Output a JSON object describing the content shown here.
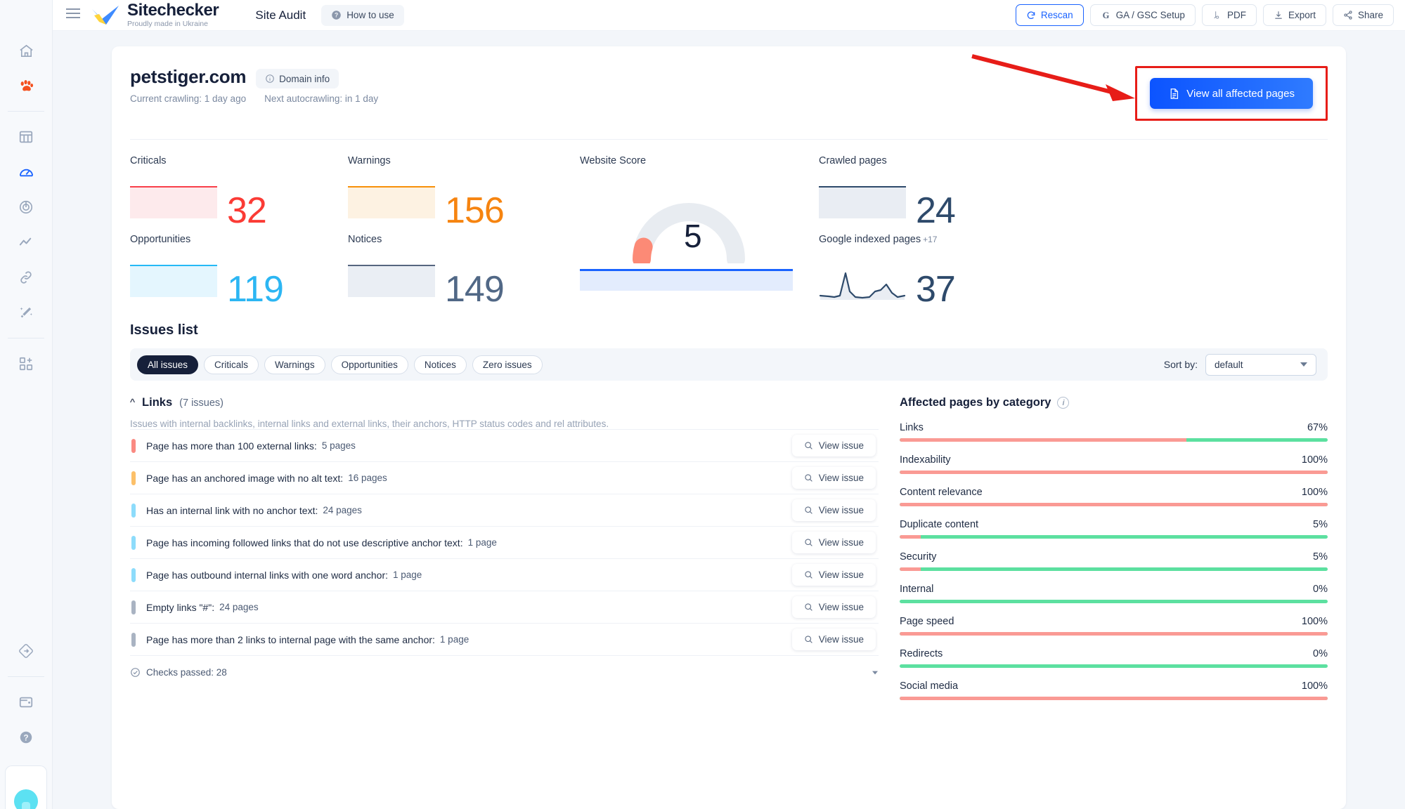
{
  "topbar": {
    "menu_icon": "hamburger-icon",
    "brand_name": "Sitechecker",
    "brand_tagline": "Proudly made in Ukraine",
    "nav_title": "Site Audit",
    "how_to_use": "How to use",
    "buttons": [
      {
        "label": "Rescan",
        "icon": "refresh-icon",
        "primary": true
      },
      {
        "label": "GA / GSC Setup",
        "icon": "google-icon",
        "primary": false
      },
      {
        "label": "PDF",
        "icon": "pdf-icon",
        "primary": false
      },
      {
        "label": "Export",
        "icon": "download-icon",
        "primary": false
      },
      {
        "label": "Share",
        "icon": "share-icon",
        "primary": false
      }
    ]
  },
  "sidebar": {
    "items": [
      {
        "name": "home",
        "icon": "home-icon",
        "active": false
      },
      {
        "name": "paw",
        "icon": "paw-icon",
        "active": false
      },
      {
        "name": "dashboard",
        "icon": "columns-icon",
        "active": false
      },
      {
        "name": "site-audit",
        "icon": "speedometer-icon",
        "active": true
      },
      {
        "name": "rank-tracker",
        "icon": "radar-icon",
        "active": false
      },
      {
        "name": "traffic",
        "icon": "line-chart-icon",
        "active": false
      },
      {
        "name": "backlinks",
        "icon": "link-icon",
        "active": false
      },
      {
        "name": "ai-tools",
        "icon": "magic-wand-icon",
        "active": false
      },
      {
        "name": "add-project",
        "icon": "add-squares-icon",
        "active": false
      },
      {
        "name": "redirects",
        "icon": "diamond-arrow-icon",
        "active": false
      },
      {
        "name": "billing",
        "icon": "wallet-icon",
        "active": false
      },
      {
        "name": "help",
        "icon": "question-circle-icon",
        "active": false
      }
    ]
  },
  "header": {
    "domain": "petstiger.com",
    "domain_info": "Domain info",
    "current_crawling": "Current crawling: 1 day ago",
    "next_autocrawling": "Next autocrawling: in 1 day",
    "cta_label": "View all affected pages",
    "cta_icon": "document-icon",
    "highlight_color": "#e71d18",
    "arrow_color": "#e71d18"
  },
  "metrics": {
    "criticals": {
      "label": "Criticals",
      "value": "32",
      "color": "#fb3b35"
    },
    "warnings": {
      "label": "Warnings",
      "value": "156",
      "color": "#f68410"
    },
    "opportunities": {
      "label": "Opportunities",
      "value": "119",
      "color": "#2cb6f3"
    },
    "notices": {
      "label": "Notices",
      "value": "149",
      "color": "#516886"
    },
    "crawled": {
      "label": "Crawled pages",
      "value": "24",
      "color": "#2e4a6b"
    },
    "indexed": {
      "label": "Google indexed pages",
      "delta": "+17",
      "value": "37",
      "color": "#2e4a6b"
    },
    "score": {
      "label": "Website Score",
      "value": "5",
      "gauge_color": "#fc8a76",
      "track_color": "#e8ecf1",
      "bar_color": "#1a63ff"
    }
  },
  "issues_section": {
    "title": "Issues list",
    "filters": [
      {
        "label": "All issues",
        "active": true
      },
      {
        "label": "Criticals",
        "active": false
      },
      {
        "label": "Warnings",
        "active": false
      },
      {
        "label": "Opportunities",
        "active": false
      },
      {
        "label": "Notices",
        "active": false
      },
      {
        "label": "Zero issues",
        "active": false
      }
    ],
    "sort_label": "Sort by:",
    "sort_value": "default",
    "group": {
      "name": "Links",
      "count": "(7 issues)",
      "description": "Issues with internal backlinks, internal links and external links, their anchors, HTTP status codes and rel attributes."
    },
    "view_issue_label": "View issue",
    "checks_passed": "Checks passed: 28",
    "rows": [
      {
        "text": "Page has more than 100 external links:",
        "pages": "5 pages",
        "severity": "#fa8a82"
      },
      {
        "text": "Page has an anchored image with no alt text:",
        "pages": "16 pages",
        "severity": "#fcc069"
      },
      {
        "text": "Has an internal link with no anchor text:",
        "pages": "24 pages",
        "severity": "#8ddcfb"
      },
      {
        "text": "Page has incoming followed links that do not use descriptive anchor text:",
        "pages": "1 page",
        "severity": "#8ddcfb"
      },
      {
        "text": "Page has outbound internal links with one word anchor:",
        "pages": "1 page",
        "severity": "#8ddcfb"
      },
      {
        "text": "Empty links \"#\":",
        "pages": "24 pages",
        "severity": "#a9b3c2"
      },
      {
        "text": "Page has more than 2 links to internal page with the same anchor:",
        "pages": "1 page",
        "severity": "#a9b3c2"
      }
    ]
  },
  "affected": {
    "title": "Affected pages by category",
    "info_icon": "info-icon",
    "bad_color": "#fa9a94",
    "good_color": "#5ce0a0",
    "categories": [
      {
        "name": "Links",
        "percent": "67%",
        "value": 67
      },
      {
        "name": "Indexability",
        "percent": "100%",
        "value": 100
      },
      {
        "name": "Content relevance",
        "percent": "100%",
        "value": 100
      },
      {
        "name": "Duplicate content",
        "percent": "5%",
        "value": 5
      },
      {
        "name": "Security",
        "percent": "5%",
        "value": 5
      },
      {
        "name": "Internal",
        "percent": "0%",
        "value": 0
      },
      {
        "name": "Page speed",
        "percent": "100%",
        "value": 100
      },
      {
        "name": "Redirects",
        "percent": "0%",
        "value": 0
      },
      {
        "name": "Social media",
        "percent": "100%",
        "value": 100
      }
    ]
  }
}
